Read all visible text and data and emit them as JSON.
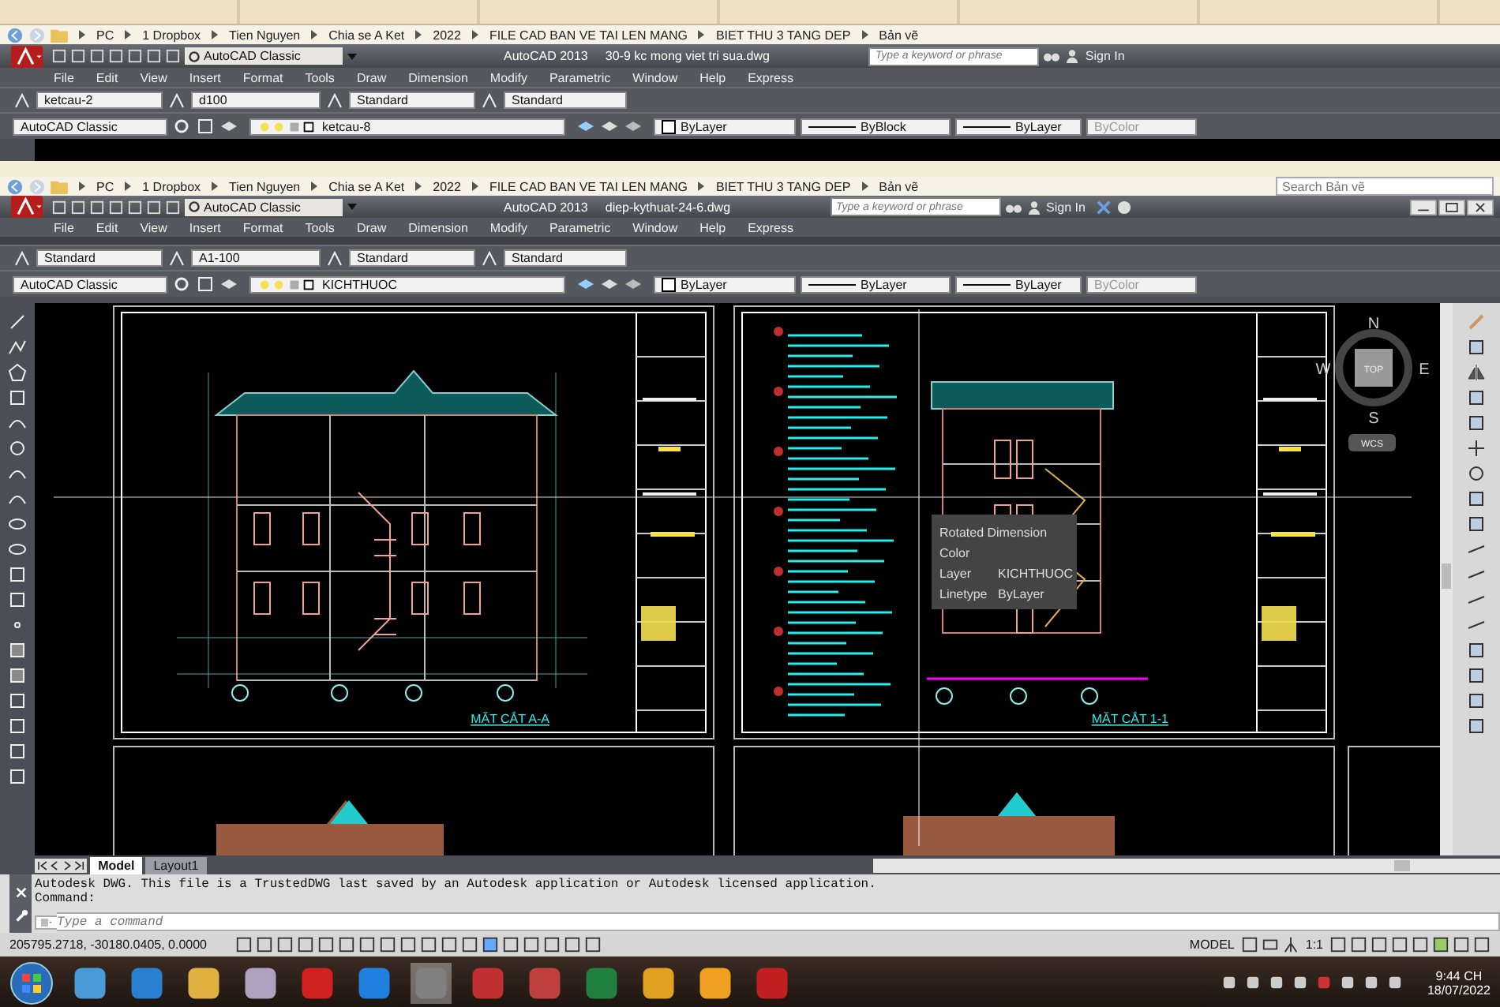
{
  "explorer_bars": [
    {
      "path": [
        "PC",
        "1 Dropbox",
        "Tien Nguyen",
        "Chia se A Ket",
        "2022",
        "FILE CAD BAN VE TAI LEN MANG",
        "BIET THU 3 TANG DEP",
        "Bản vẽ"
      ]
    },
    {
      "path": [
        "PC",
        "1 Dropbox",
        "Tien Nguyen",
        "Chia se A Ket",
        "2022",
        "FILE CAD BAN VE TAI LEN MANG",
        "BIET THU 3 TANG DEP",
        "Bản vẽ"
      ],
      "search_placeholder": "Search Bản vẽ"
    }
  ],
  "windows": [
    {
      "app": "AutoCAD 2013",
      "file": "30-9 kc mong viet tri sua.dwg",
      "workspace": "AutoCAD Classic",
      "search_placeholder": "Type a keyword or phrase",
      "sign_in": "Sign In",
      "window_controls": false,
      "menus": [
        "File",
        "Edit",
        "View",
        "Insert",
        "Format",
        "Tools",
        "Draw",
        "Dimension",
        "Modify",
        "Parametric",
        "Window",
        "Help",
        "Express"
      ],
      "styles": [
        "ketcau-2",
        "d100",
        "Standard",
        "Standard"
      ],
      "properties": {
        "workspace": "AutoCAD Classic",
        "layer": "ketcau-8",
        "color_setting": "ByLayer",
        "linetype": "ByBlock",
        "lineweight": "ByLayer",
        "plot_style": "ByColor"
      }
    },
    {
      "app": "AutoCAD 2013",
      "file": "diep-kythuat-24-6.dwg",
      "workspace": "AutoCAD Classic",
      "search_placeholder": "Type a keyword or phrase",
      "sign_in": "Sign In",
      "window_controls": true,
      "menus": [
        "File",
        "Edit",
        "View",
        "Insert",
        "Format",
        "Tools",
        "Draw",
        "Dimension",
        "Modify",
        "Parametric",
        "Window",
        "Help",
        "Express"
      ],
      "styles": [
        "Standard",
        "A1-100",
        "Standard",
        "Standard"
      ],
      "properties": {
        "workspace": "AutoCAD Classic",
        "layer": "KICHTHUOC",
        "color_setting": "ByLayer",
        "linetype": "ByLayer",
        "lineweight": "ByLayer",
        "plot_style": "ByColor"
      }
    }
  ],
  "drawing": {
    "sheets": [
      {
        "title": "MẶT CẮT A-A"
      },
      {
        "title": "MẶT CẮT 1-1"
      }
    ],
    "viewcube": {
      "north": "N",
      "west": "W",
      "east": "E",
      "south": "S",
      "face": "TOP",
      "ucs": "WCS"
    },
    "tooltip": {
      "title": "Rotated Dimension",
      "rows": [
        {
          "label": "Color"
        },
        {
          "label": "Layer",
          "value": "KICHTHUOC"
        },
        {
          "label": "Linetype",
          "value": "ByLayer"
        }
      ]
    }
  },
  "layout_tabs": [
    {
      "label": "Model",
      "selected": true
    },
    {
      "label": "Layout1",
      "selected": false
    }
  ],
  "command_line": {
    "history": [
      "Autodesk DWG.  This file is a TrustedDWG last saved by an Autodesk application or Autodesk licensed application.",
      "Command:"
    ],
    "placeholder": "Type a command"
  },
  "status_bar": {
    "coordinates": "205795.2718, -30180.0405, 0.0000",
    "space": "MODEL",
    "scale": "1:1"
  },
  "taskbar": {
    "time": "9:44 CH",
    "date": "18/07/2022"
  }
}
